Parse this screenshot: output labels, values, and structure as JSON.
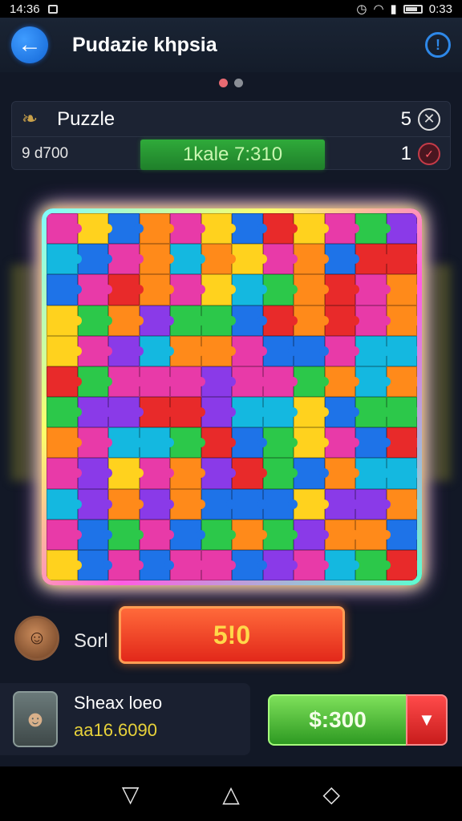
{
  "status_bar": {
    "time": "14:36",
    "clock_right": "0:33"
  },
  "app_bar": {
    "back_icon": "←",
    "title": "Pudazie khpsia",
    "info_icon": "!"
  },
  "pager": {
    "active_color": "#e86a72",
    "inactive_color": "#8a8e96"
  },
  "info_panel": {
    "icon": "❧",
    "label": "Puzzle",
    "count": "5",
    "close_icon": "✕",
    "score": "9 d700",
    "timer": "1kale 7:310",
    "level": "1",
    "level_icon": "✓"
  },
  "board": {
    "colors": [
      "#1e73e8",
      "#ff8a1a",
      "#2cc84a",
      "#e83aa8",
      "#ffd21e",
      "#14b8e0",
      "#8a3ae8",
      "#e82a2a"
    ]
  },
  "actions": {
    "avatar_icon": "☺",
    "sort_label": "Sorl",
    "play_label": "5!0"
  },
  "user": {
    "avatar_icon": "☻",
    "name": "Sheax loeo",
    "score": "aa16.6090"
  },
  "purchase": {
    "price": "$:300",
    "dropdown_icon": "▼"
  },
  "nav": {
    "back": "▽",
    "home": "△",
    "recents": "◇"
  }
}
